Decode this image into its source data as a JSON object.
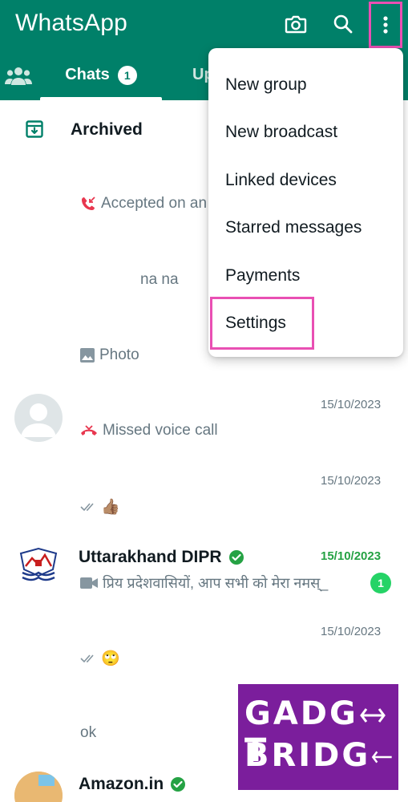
{
  "header": {
    "title": "WhatsApp",
    "icons": [
      "camera-icon",
      "search-icon",
      "more-vert-icon"
    ]
  },
  "tabs": {
    "chats_label": "Chats",
    "chats_badge": "1",
    "updates_label": "Up"
  },
  "archived": {
    "label": "Archived"
  },
  "chats": [
    {
      "message": "Accepted on an",
      "time": ""
    },
    {
      "message": "na na",
      "time": ""
    },
    {
      "message": "Photo",
      "time": ""
    },
    {
      "message": "Missed voice call",
      "time": "15/10/2023"
    },
    {
      "message": "👍🏽",
      "time": "15/10/2023"
    },
    {
      "name": "Uttarakhand DIPR",
      "message": "प्रिय प्रदेशवासियों,  आप सभी को मेरा नमस्_",
      "time": "15/10/2023",
      "unread": "1"
    },
    {
      "message": "🙄",
      "time": "15/10/2023"
    },
    {
      "message": "ok",
      "time": ""
    },
    {
      "name": "Amazon.in",
      "message": "",
      "time": ""
    }
  ],
  "menu": {
    "items": [
      "New group",
      "New broadcast",
      "Linked devices",
      "Starred messages",
      "Payments",
      "Settings"
    ],
    "highlighted": "Settings"
  },
  "colors": {
    "brand": "#008069",
    "highlight": "#e94fb3",
    "unread": "#25d366",
    "missed_call": "#e8374f",
    "watermark_bg": "#7b1e9c"
  },
  "watermark": {
    "line1": "GADG",
    "line2": "BRIDG"
  }
}
